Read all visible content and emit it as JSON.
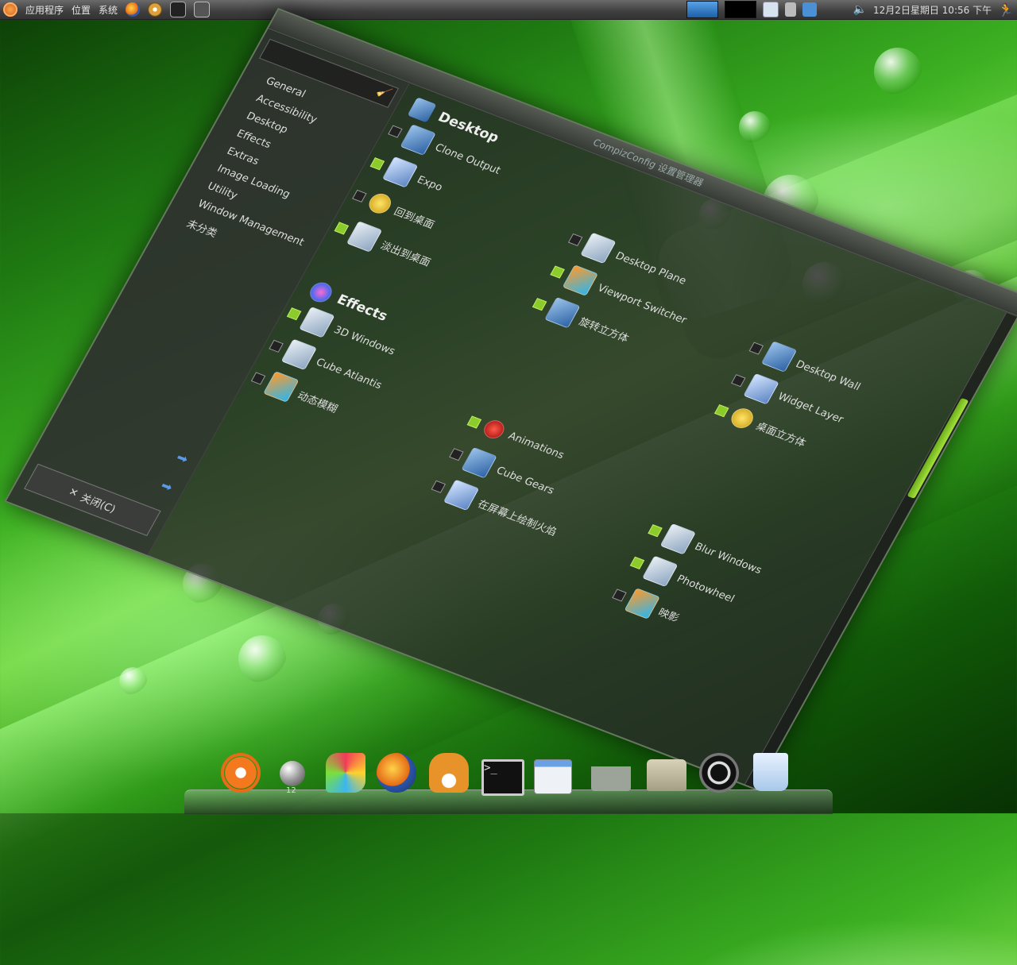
{
  "top_panel": {
    "menus": [
      "应用程序",
      "位置",
      "系统"
    ],
    "launchers": [
      "firefox-icon",
      "evolution-icon",
      "terminal-icon",
      "screenshot-icon"
    ],
    "clock": "12月2日星期日 10:56 下午"
  },
  "window": {
    "title": "CompizConfig 设置管理器",
    "search_placeholder": "",
    "categories": [
      "General",
      "Accessibility",
      "Desktop",
      "Effects",
      "Extras",
      "Image Loading",
      "Utility",
      "Window Management",
      "未分类"
    ],
    "close_label": "关闭(C)",
    "sections": [
      {
        "title": "Desktop",
        "plugins": [
          {
            "name": "Clone Output",
            "checked": false
          },
          {
            "name": "",
            "checked": false
          },
          {
            "name": "",
            "checked": false
          },
          {
            "name": "Expo",
            "checked": true
          },
          {
            "name": "Desktop Plane",
            "checked": false
          },
          {
            "name": "",
            "checked": false
          },
          {
            "name": "回到桌面",
            "checked": false
          },
          {
            "name": "Viewport Switcher",
            "checked": true
          },
          {
            "name": "Desktop Wall",
            "checked": false
          },
          {
            "name": "淡出到桌面",
            "checked": true
          },
          {
            "name": "旋转立方体",
            "checked": true
          },
          {
            "name": "Widget Layer",
            "checked": false
          },
          {
            "name": "",
            "checked": false
          },
          {
            "name": "",
            "checked": false
          },
          {
            "name": "桌面立方体",
            "checked": true
          }
        ]
      },
      {
        "title": "Effects",
        "plugins": [
          {
            "name": "3D Windows",
            "checked": true
          },
          {
            "name": "",
            "checked": false
          },
          {
            "name": "",
            "checked": false
          },
          {
            "name": "Cube Atlantis",
            "checked": false
          },
          {
            "name": "Animations",
            "checked": true
          },
          {
            "name": "",
            "checked": false
          },
          {
            "name": "动态模糊",
            "checked": false
          },
          {
            "name": "Cube Gears",
            "checked": false
          },
          {
            "name": "Blur Windows",
            "checked": true
          },
          {
            "name": "",
            "checked": false
          },
          {
            "name": "在屏幕上绘制火焰",
            "checked": false
          },
          {
            "name": "Photowheel",
            "checked": true
          },
          {
            "name": "",
            "checked": false
          },
          {
            "name": "",
            "checked": false
          },
          {
            "name": "映影",
            "checked": false
          }
        ]
      }
    ]
  },
  "dock": {
    "items": [
      "ubuntu-icon",
      "ball-icon",
      "photo-icon",
      "firefox-icon",
      "fox-icon",
      "terminal-icon",
      "settings-icon",
      "download-icon",
      "folder-icon",
      "power-icon",
      "trash-icon"
    ],
    "label": "12"
  },
  "colors": {
    "accent": "#8ccc2a",
    "panel": "#3e3e3e"
  }
}
